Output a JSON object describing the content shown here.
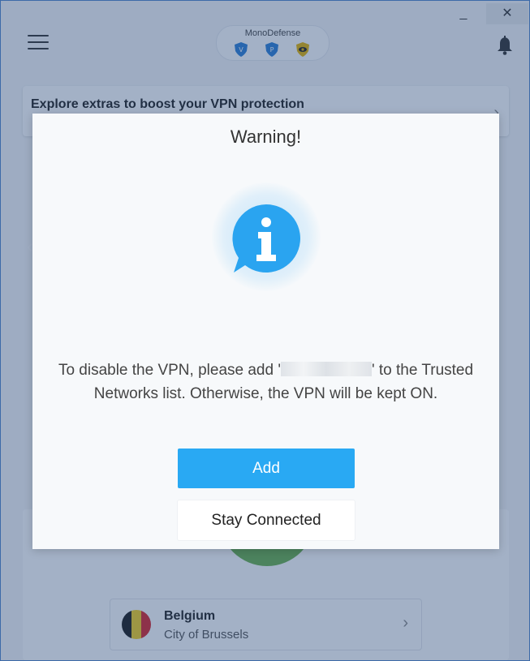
{
  "app": {
    "title": "MonoDefense",
    "window_controls": {
      "minimize": "_",
      "close": "✕"
    }
  },
  "header": {
    "menu_icon": "hamburger-menu-icon",
    "product_icons": [
      "vpn-shield-icon",
      "password-shield-icon",
      "antivirus-eye-icon"
    ],
    "notification_icon": "bell-icon"
  },
  "promo": {
    "title": "Explore extras to boost your VPN protection",
    "chevron": "›"
  },
  "location": {
    "country": "Belgium",
    "city": "City of Brussels",
    "chevron": "›",
    "flag_colors": [
      "#1a1a1a",
      "#f5d020",
      "#d9252a"
    ]
  },
  "dialog": {
    "title": "Warning!",
    "icon": "info-speech-bubble-icon",
    "message_before": "To disable the VPN, please add '",
    "message_after": "' to the Trusted Networks list. Otherwise, the VPN will be kept ON.",
    "primary_button": "Add",
    "secondary_button": "Stay Connected"
  },
  "colors": {
    "accent": "#29a9f3",
    "overlay": "rgba(35,70,120,0.42)",
    "connected_green": "#6ab04c"
  }
}
